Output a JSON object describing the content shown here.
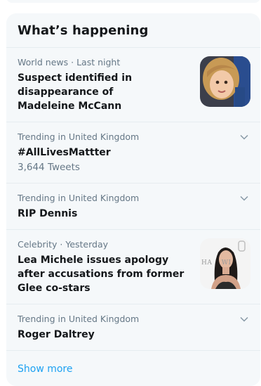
{
  "trends": {
    "title": "What’s happening",
    "items": [
      {
        "meta": "World news · Last night",
        "headline": "Suspect identified in disappearance of Madeleine McCann"
      },
      {
        "meta": "Trending in United Kingdom",
        "headline": "#AllLivesMattter",
        "count": "3,644 Tweets"
      },
      {
        "meta": "Trending in United Kingdom",
        "headline": "RIP Dennis"
      },
      {
        "meta": "Celebrity · Yesterday",
        "headline": "Lea Michele issues apology after accusations from former Glee co-stars",
        "photo_backdrop_text": "HA    WI"
      },
      {
        "meta": "Trending in United Kingdom",
        "headline": "Roger Daltrey"
      }
    ],
    "show_more": "Show more"
  },
  "colors": {
    "panel_bg": "#f5f8fa",
    "divider": "#e6ecf0",
    "text_primary": "#14171a",
    "text_secondary": "#657786",
    "accent": "#1da1f2"
  },
  "icons": {
    "more_menu": "chevron-down-icon"
  }
}
